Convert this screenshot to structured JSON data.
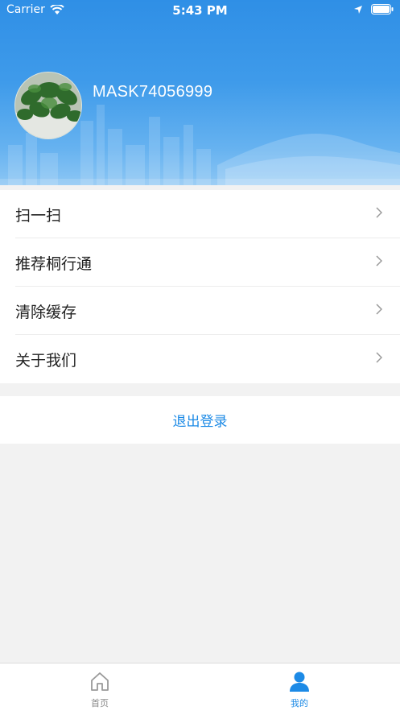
{
  "status_bar": {
    "carrier": "Carrier",
    "time": "5:43 PM"
  },
  "profile": {
    "username": "MASK74056999"
  },
  "menu": {
    "items": [
      {
        "label": "扫一扫"
      },
      {
        "label": "推荐桐行通"
      },
      {
        "label": "清除缓存"
      },
      {
        "label": "关于我们"
      }
    ]
  },
  "logout": {
    "label": "退出登录"
  },
  "tabbar": {
    "tabs": [
      {
        "label": "首页",
        "icon": "home-icon",
        "active": false
      },
      {
        "label": "我的",
        "icon": "person-icon",
        "active": true
      }
    ]
  },
  "colors": {
    "header_blue": "#2f8fe6",
    "accent": "#1c8ae6",
    "inactive_tab": "#888888",
    "background": "#f2f2f2"
  }
}
